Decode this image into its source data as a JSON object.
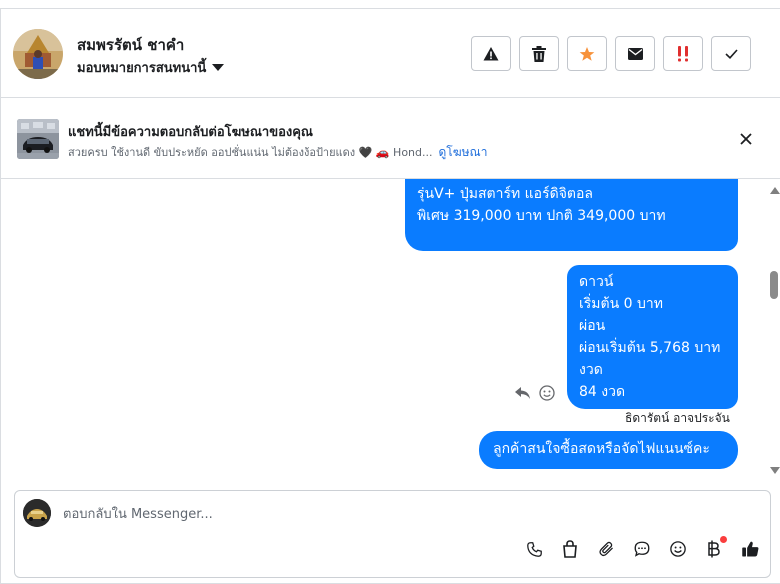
{
  "header": {
    "contact_name": "สมพรรัตน์ ชาคำ",
    "assign_label": "มอบหมายการสนทนานี้"
  },
  "actions": [
    {
      "name": "report-button",
      "icon": "warning-icon"
    },
    {
      "name": "delete-button",
      "icon": "trash-icon"
    },
    {
      "name": "star-button",
      "icon": "star-icon"
    },
    {
      "name": "mark-unread-button",
      "icon": "envelope-icon"
    },
    {
      "name": "spam-button",
      "icon": "double-exclamation-icon"
    },
    {
      "name": "done-button",
      "icon": "check-icon"
    }
  ],
  "colors": {
    "accent": "#0a7cff",
    "star": "#f7923b",
    "spam": "#e02f2f",
    "link": "#216fdb"
  },
  "ad": {
    "title": "แชทนี้มีข้อความตอบกลับต่อโฆษณาของคุณ",
    "description": "สวยครบ ใช้งานดี ขับประหยัด ออปชั่นแน่น ไม่ต้องง้อป้ายแดง 🖤 🚗 Hond...",
    "link": "ดูโฆษณา"
  },
  "messages": [
    {
      "lines": [
        "รุ่นV+ ปุ่มสตาร์ท แอร์ดิจิตอล",
        "พิเศษ 319,000 บาท  ปกติ 349,000 บาท"
      ]
    },
    {
      "lines": [
        "ดาวน์",
        "เริ่มต้น 0 บาท",
        "ผ่อน",
        "ผ่อนเริ่มต้น 5,768 บาท",
        "งวด",
        "84 งวด"
      ]
    },
    {
      "lines": [
        "ลูกค้าสนใจซื้อสดหรือจัดไฟแนนซ์คะ"
      ]
    }
  ],
  "sender_name": "ธิดารัตน์ อาจประจัน",
  "composer": {
    "placeholder": "ตอบกลับใน Messenger..."
  }
}
